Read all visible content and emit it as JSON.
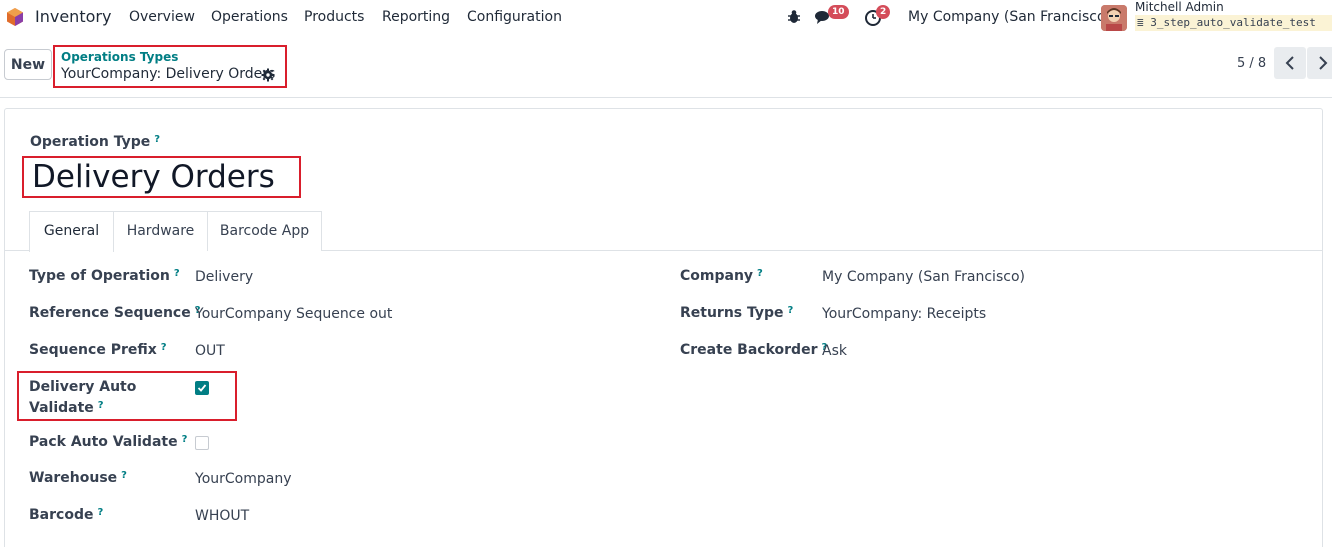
{
  "nav": {
    "app_name": "Inventory",
    "menu": [
      "Overview",
      "Operations",
      "Products",
      "Reporting",
      "Configuration"
    ],
    "messages_count": "10",
    "activities_count": "2",
    "company": "My Company (San Francisco)",
    "user_name": "Mitchell Admin",
    "database": "3_step_auto_validate_test"
  },
  "control": {
    "new_label": "New",
    "breadcrumb_parent": "Operations Types",
    "breadcrumb_current": "YourCompany: Delivery Orders",
    "pager": "5 / 8"
  },
  "form": {
    "name_label": "Operation Type",
    "name_value": "Delivery Orders",
    "tabs": [
      "General",
      "Hardware",
      "Barcode App"
    ],
    "left_fields": [
      {
        "label": "Type of Operation",
        "value": "Delivery"
      },
      {
        "label": "Reference Sequence",
        "value": "YourCompany Sequence out"
      },
      {
        "label": "Sequence Prefix",
        "value": "OUT"
      },
      {
        "label": "Delivery Auto",
        "label2": "Validate",
        "value": "checked"
      },
      {
        "label": "Pack Auto Validate",
        "value": "unchecked"
      },
      {
        "label": "Warehouse",
        "value": "YourCompany"
      },
      {
        "label": "Barcode",
        "value": "WHOUT"
      }
    ],
    "right_fields": [
      {
        "label": "Company",
        "value": "My Company (San Francisco)"
      },
      {
        "label": "Returns Type",
        "value": "YourCompany: Receipts"
      },
      {
        "label": "Create Backorder",
        "value": "Ask"
      }
    ],
    "help_mark": "?"
  },
  "colors": {
    "accent": "#017e84",
    "highlight": "#d91e2c",
    "badge": "#d44c59"
  }
}
